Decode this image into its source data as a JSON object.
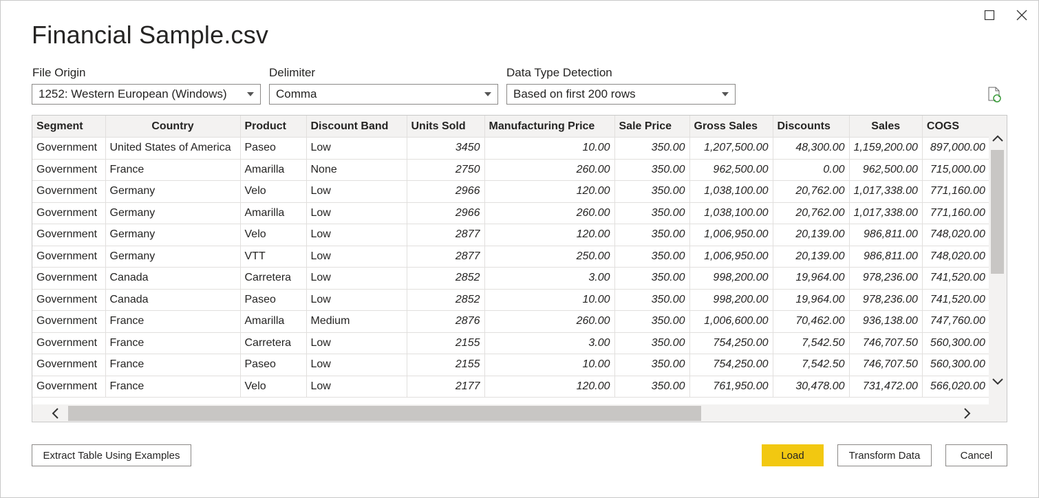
{
  "dialog": {
    "title": "Financial Sample.csv"
  },
  "options": {
    "file_origin": {
      "label": "File Origin",
      "value": "1252: Western European (Windows)"
    },
    "delimiter": {
      "label": "Delimiter",
      "value": "Comma"
    },
    "data_type_detection": {
      "label": "Data Type Detection",
      "value": "Based on first 200 rows"
    }
  },
  "table": {
    "columns": [
      "Segment",
      "Country",
      "Product",
      "Discount Band",
      "Units Sold",
      "Manufacturing Price",
      "Sale Price",
      "Gross Sales",
      "Discounts",
      "Sales",
      "COGS"
    ],
    "rows": [
      [
        "Government",
        "United States of America",
        "Paseo",
        "Low",
        "3450",
        "10.00",
        "350.00",
        "1,207,500.00",
        "48,300.00",
        "1,159,200.00",
        "897,000.00"
      ],
      [
        "Government",
        "France",
        "Amarilla",
        "None",
        "2750",
        "260.00",
        "350.00",
        "962,500.00",
        "0.00",
        "962,500.00",
        "715,000.00"
      ],
      [
        "Government",
        "Germany",
        "Velo",
        "Low",
        "2966",
        "120.00",
        "350.00",
        "1,038,100.00",
        "20,762.00",
        "1,017,338.00",
        "771,160.00"
      ],
      [
        "Government",
        "Germany",
        "Amarilla",
        "Low",
        "2966",
        "260.00",
        "350.00",
        "1,038,100.00",
        "20,762.00",
        "1,017,338.00",
        "771,160.00"
      ],
      [
        "Government",
        "Germany",
        "Velo",
        "Low",
        "2877",
        "120.00",
        "350.00",
        "1,006,950.00",
        "20,139.00",
        "986,811.00",
        "748,020.00"
      ],
      [
        "Government",
        "Germany",
        "VTT",
        "Low",
        "2877",
        "250.00",
        "350.00",
        "1,006,950.00",
        "20,139.00",
        "986,811.00",
        "748,020.00"
      ],
      [
        "Government",
        "Canada",
        "Carretera",
        "Low",
        "2852",
        "3.00",
        "350.00",
        "998,200.00",
        "19,964.00",
        "978,236.00",
        "741,520.00"
      ],
      [
        "Government",
        "Canada",
        "Paseo",
        "Low",
        "2852",
        "10.00",
        "350.00",
        "998,200.00",
        "19,964.00",
        "978,236.00",
        "741,520.00"
      ],
      [
        "Government",
        "France",
        "Amarilla",
        "Medium",
        "2876",
        "260.00",
        "350.00",
        "1,006,600.00",
        "70,462.00",
        "936,138.00",
        "747,760.00"
      ],
      [
        "Government",
        "France",
        "Carretera",
        "Low",
        "2155",
        "3.00",
        "350.00",
        "754,250.00",
        "7,542.50",
        "746,707.50",
        "560,300.00"
      ],
      [
        "Government",
        "France",
        "Paseo",
        "Low",
        "2155",
        "10.00",
        "350.00",
        "754,250.00",
        "7,542.50",
        "746,707.50",
        "560,300.00"
      ],
      [
        "Government",
        "France",
        "Velo",
        "Low",
        "2177",
        "120.00",
        "350.00",
        "761,950.00",
        "30,478.00",
        "731,472.00",
        "566,020.00"
      ]
    ]
  },
  "buttons": {
    "extract": "Extract Table Using Examples",
    "load": "Load",
    "transform": "Transform Data",
    "cancel": "Cancel"
  },
  "colors": {
    "accent": "#f2c811",
    "header_bg": "#f3f2f1",
    "border": "#8a8886"
  },
  "icons": [
    "maximize-icon",
    "close-icon",
    "chevron-down-icon",
    "refresh-preview-icon",
    "scroll-up-icon",
    "scroll-down-icon",
    "scroll-left-icon",
    "scroll-right-icon"
  ]
}
